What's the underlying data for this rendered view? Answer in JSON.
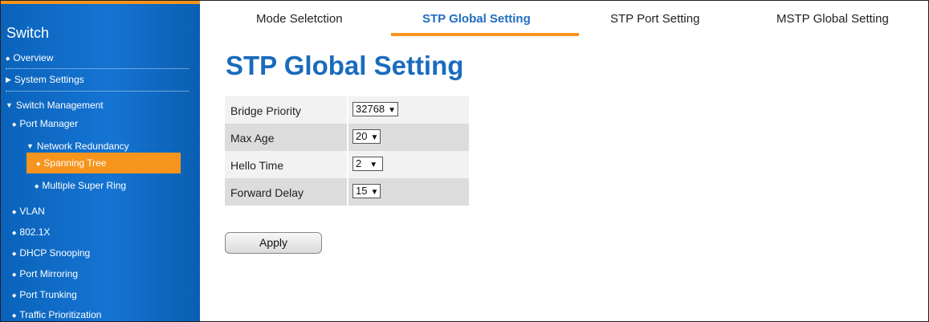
{
  "sidebar": {
    "title": "Switch",
    "items": [
      {
        "label": "Overview"
      },
      {
        "label": "System Settings"
      },
      {
        "label": "Switch Management"
      },
      {
        "label": "Port Manager"
      },
      {
        "label": "Network Redundancy"
      },
      {
        "label": "Spanning Tree"
      },
      {
        "label": "Multiple Super Ring"
      },
      {
        "label": "VLAN"
      },
      {
        "label": "802.1X"
      },
      {
        "label": "DHCP Snooping"
      },
      {
        "label": "Port Mirroring"
      },
      {
        "label": "Port Trunking"
      },
      {
        "label": "Traffic Prioritization"
      }
    ]
  },
  "tabs": [
    {
      "label": "Mode Seletction"
    },
    {
      "label": "STP Global Setting"
    },
    {
      "label": "STP Port Setting"
    },
    {
      "label": "MSTP Global Setting"
    }
  ],
  "main": {
    "title": "STP Global Setting",
    "settings": [
      {
        "label": "Bridge Priority",
        "value": "32768"
      },
      {
        "label": "Max Age",
        "value": "20"
      },
      {
        "label": "Hello Time",
        "value": "2"
      },
      {
        "label": "Forward Delay",
        "value": "15"
      }
    ],
    "apply_label": "Apply"
  },
  "colors": {
    "accent": "#f7941d",
    "sidebar": "#1574d3",
    "title": "#1a6bbd"
  }
}
